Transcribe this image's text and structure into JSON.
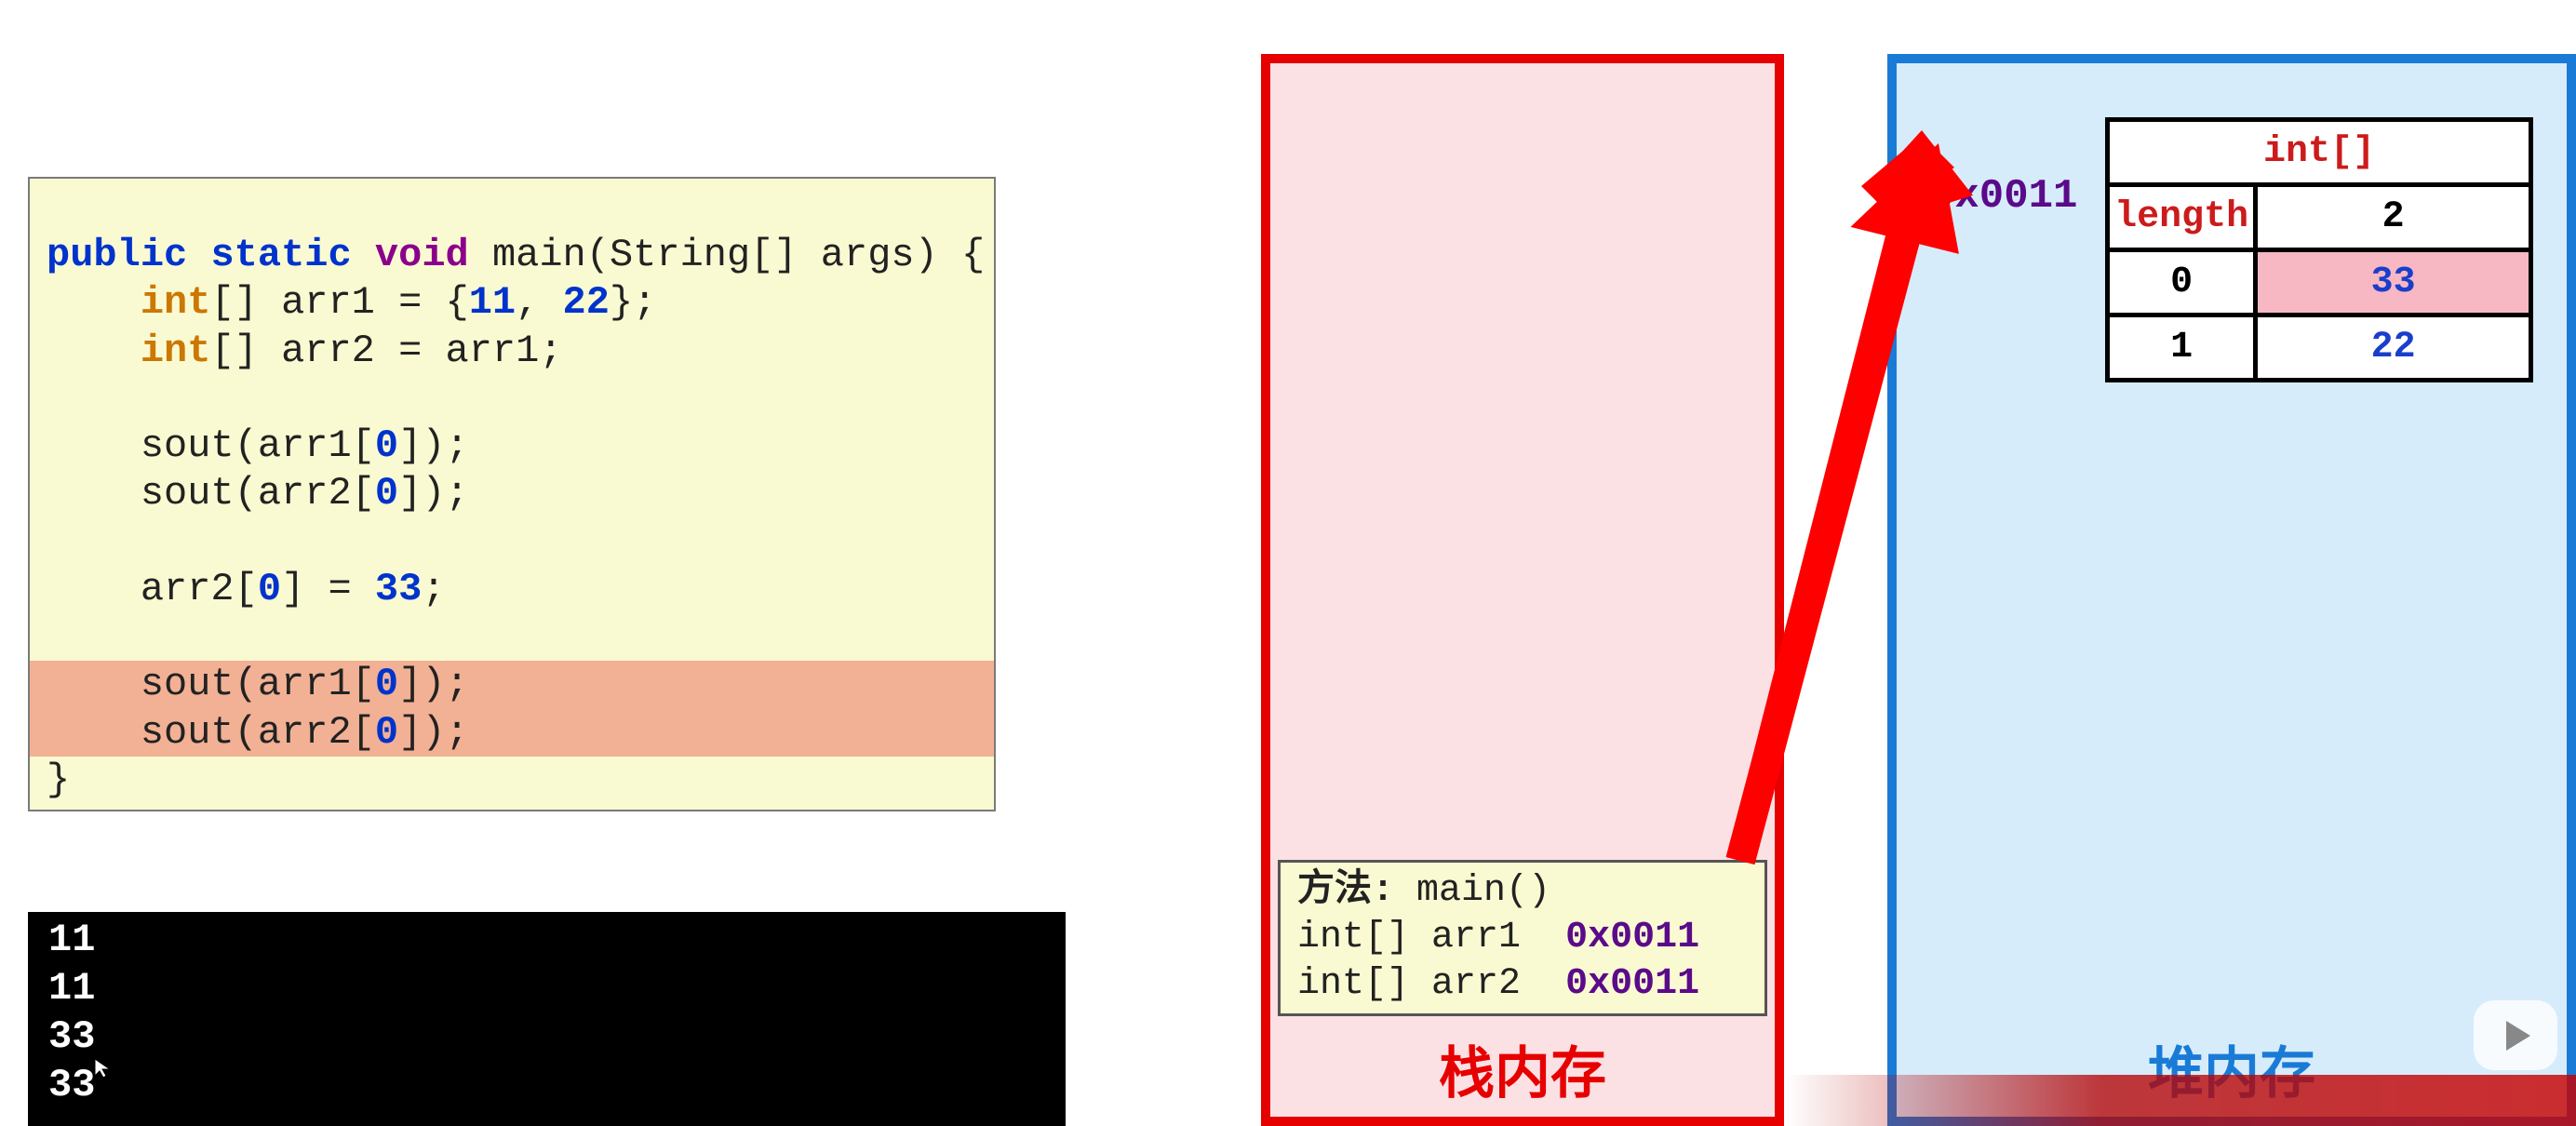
{
  "code": {
    "sig_public": "public",
    "sig_static": "static",
    "sig_void": "void",
    "sig_rest": " main(String[] args) {",
    "l2_kw": "int",
    "l2_rest": "[] arr1 = {",
    "l2_n1": "11",
    "l2_n2": "22",
    "l2_tail": "};",
    "l3_kw": "int",
    "l3_rest": "[] arr2 = arr1;",
    "l5_pre": "    sout(arr1[",
    "l5_idx": "0",
    "l5_post": "]);",
    "l6_pre": "    sout(arr2[",
    "l6_idx": "0",
    "l6_post": "]);",
    "l8_pre": "    arr2[",
    "l8_idx": "0",
    "l8_mid": "] = ",
    "l8_val": "33",
    "l8_post": ";",
    "l10_pre": "    sout(arr1[",
    "l10_idx": "0",
    "l10_post": "]);",
    "l11_pre": "    sout(arr2[",
    "l11_idx": "0",
    "l11_post": "]);",
    "close": "}"
  },
  "console": {
    "l1": "11",
    "l2": "11",
    "l3": "33",
    "l4": "33"
  },
  "stack": {
    "label": "栈内存",
    "method_label": "方法:",
    "method_name": " main()",
    "var1_type": "int[] arr1",
    "var1_addr": "0x0011",
    "var2_type": "int[] arr2",
    "var2_addr": "0x0011"
  },
  "heap": {
    "label": "堆内存",
    "addr": "0x0011",
    "type": "int[]",
    "length_label": "length",
    "length_val": "2",
    "idx0": "0",
    "val0": "33",
    "idx1": "1",
    "val1": "22"
  },
  "banner": ""
}
